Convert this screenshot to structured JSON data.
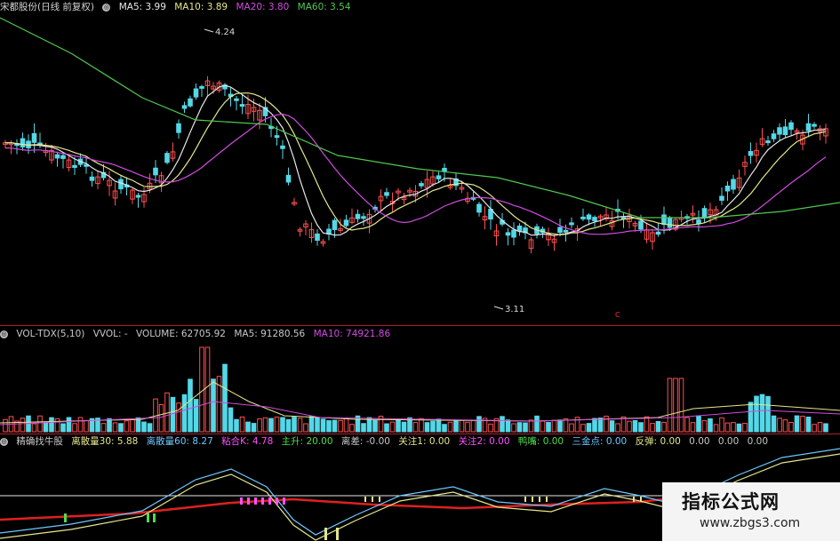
{
  "main": {
    "stock": "宋都股份(日线 前复权)",
    "ma": [
      {
        "label": "MA5: 3.99",
        "color": "#e8e8e8"
      },
      {
        "label": "MA10: 3.89",
        "color": "#e6e68c"
      },
      {
        "label": "MA20: 3.80",
        "color": "#d24be0"
      },
      {
        "label": "MA60: 3.54",
        "color": "#50c850"
      }
    ],
    "high_label": "4.24",
    "low_label": "3.11",
    "marker": "С"
  },
  "volume": {
    "title": "VOL-TDX(5,10)",
    "items": [
      {
        "label": "VVOL: -",
        "color": "#d0d0d0"
      },
      {
        "label": "VOLUME: 62705.92",
        "color": "#d0d0d0"
      },
      {
        "label": "MA5: 91280.56",
        "color": "#d0d0d0"
      },
      {
        "label": "MA10: 74921.86",
        "color": "#d24be0"
      }
    ]
  },
  "indicator": {
    "title": "精确找牛股",
    "items": [
      {
        "label": "离散量30: 5.88",
        "color": "#e6e68c"
      },
      {
        "label": "离散量60: 8.27",
        "color": "#6ec8ff"
      },
      {
        "label": "粘合K: 4.78",
        "color": "#ff50ff"
      },
      {
        "label": "主升: 20.00",
        "color": "#50dc50"
      },
      {
        "label": "离差: -0.00",
        "color": "#d0d0d0"
      },
      {
        "label": "关注1: 0.00",
        "color": "#e6e68c"
      },
      {
        "label": "关注2: 0.00",
        "color": "#ff50ff"
      },
      {
        "label": "鸭嘴: 0.00",
        "color": "#50dc50"
      },
      {
        "label": "三金点: 0.00",
        "color": "#6ec8ff"
      },
      {
        "label": "反弹: 0.00",
        "color": "#e6e68c"
      },
      {
        "label": "0.00",
        "color": "#d0d0d0"
      },
      {
        "label": "0.00",
        "color": "#d0d0d0"
      },
      {
        "label": "0.00",
        "color": "#d0d0d0"
      }
    ]
  },
  "watermark": {
    "cn": "指标公式网",
    "en": "www.zbgs3.com"
  },
  "colors": {
    "up": "#ff5050",
    "down": "#54d8e8",
    "ma5": "#e8e8e8",
    "ma10": "#e6e68c",
    "ma20": "#d24be0",
    "ma60": "#50c850"
  }
}
